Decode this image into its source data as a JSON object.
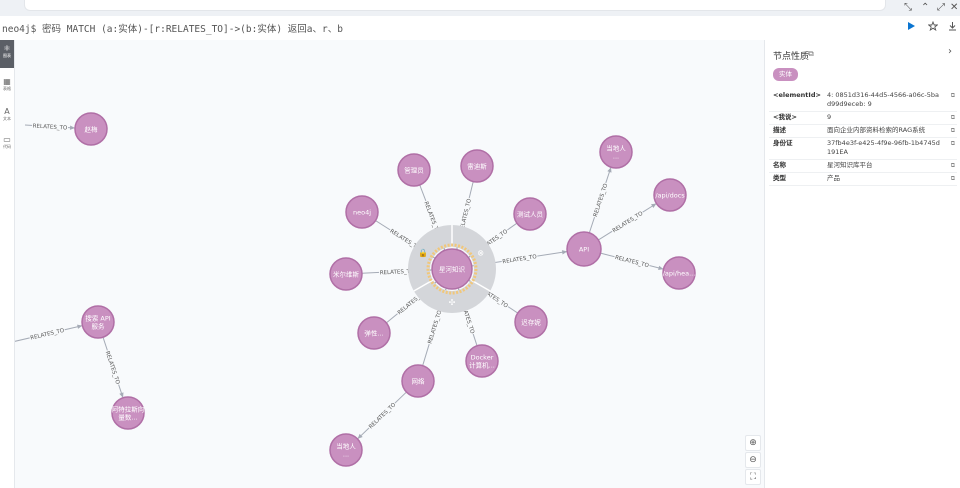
{
  "window": {
    "minimize": "–",
    "restore": "⤢",
    "close": "✕",
    "pin": "⤡",
    "collapse": "⌃"
  },
  "query": {
    "text": "neo4j$ 密码 MATCH (a:实体)-[r:RELATES_TO]->(b:实体) 返回a、r、b"
  },
  "toolbar": {
    "run_icon": "play-icon",
    "fav_icon": "star-icon",
    "download_icon": "download-icon"
  },
  "leftrail": [
    {
      "label": "图表",
      "icon": "graph-icon",
      "active": true
    },
    {
      "label": "表格",
      "icon": "table-icon",
      "active": false
    },
    {
      "label": "文本",
      "icon": "text-icon",
      "active": false
    },
    {
      "label": "代码",
      "icon": "code-icon",
      "active": false
    }
  ],
  "graph": {
    "node_color": "#c990c0",
    "node_stroke": "#b06fa6",
    "edge_color": "#a5abb6",
    "relationship_label": "RELATES_TO",
    "nodes": [
      {
        "id": "zhao",
        "label": "赵梅"
      },
      {
        "id": "search",
        "label": "搜索 API 服务"
      },
      {
        "id": "mfg",
        "label": "阿特拉斯向量数..."
      },
      {
        "id": "admin",
        "label": "管理员"
      },
      {
        "id": "leidis",
        "label": "雷迪斯"
      },
      {
        "id": "neo4j",
        "label": "neo4j"
      },
      {
        "id": "tester",
        "label": "测试人员"
      },
      {
        "id": "milvus",
        "label": "米尔维斯"
      },
      {
        "id": "center",
        "label": "星河知识"
      },
      {
        "id": "api",
        "label": "API"
      },
      {
        "id": "local1",
        "label": "当地人..."
      },
      {
        "id": "apidocs",
        "label": "/api/docs"
      },
      {
        "id": "apihea",
        "label": "/api/hea..."
      },
      {
        "id": "elastic",
        "label": "弹性..."
      },
      {
        "id": "chidi",
        "label": "迟存妮"
      },
      {
        "id": "docker",
        "label": "Docker计算机..."
      },
      {
        "id": "network",
        "label": "网络"
      },
      {
        "id": "local2",
        "label": "当地人..."
      }
    ]
  },
  "zoom": {
    "in": "⊕",
    "out": "⊖",
    "fit": "⛶"
  },
  "panel": {
    "title": "节点性质",
    "copy_icon": "copy-icon",
    "close_icon": "chevron-right-icon",
    "badge": "实体",
    "properties": [
      {
        "key": "<elementId>",
        "value": "4: 0851d316-44d5-4566-a06c-5bad99d9eceb: 9"
      },
      {
        "key": "<我说>",
        "value": "9"
      },
      {
        "key": "描述",
        "value": "面向企业内部资料检索的RAG系统"
      },
      {
        "key": "身份证",
        "value": "37fb4e3f-e425-4f9e-96fb-1b4745d191EA"
      },
      {
        "key": "名称",
        "value": "星河知识库平台"
      },
      {
        "key": "类型",
        "value": "产品"
      }
    ]
  }
}
